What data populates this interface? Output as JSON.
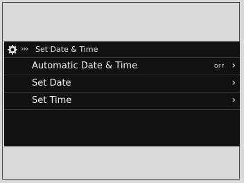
{
  "header": {
    "breadcrumb_marker": "»",
    "title": "Set Date & Time"
  },
  "menu": [
    {
      "label": "Automatic Date & Time",
      "state": "OFF",
      "chevron": "›"
    },
    {
      "label": "Set Date",
      "state": "",
      "chevron": "›"
    },
    {
      "label": "Set Time",
      "state": "",
      "chevron": "›"
    }
  ],
  "colors": {
    "background": "#d9d9d9",
    "screen": "#111111",
    "text": "#f0f0f0"
  },
  "icons": {
    "settings": "gear-icon",
    "breadcrumb": "triple-chevron-icon"
  }
}
